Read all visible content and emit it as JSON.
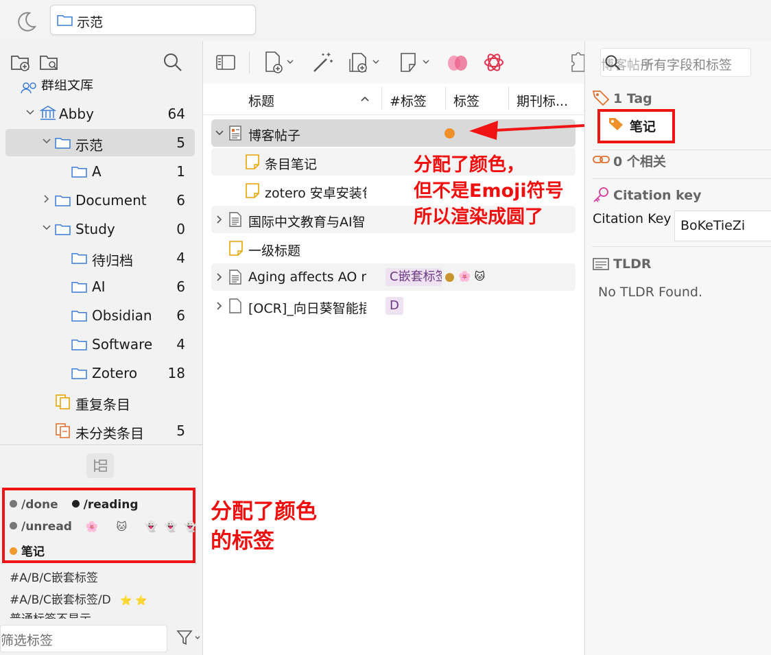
{
  "topbar": {
    "breadcrumb": "示范"
  },
  "library": {
    "group_label": "群组文库",
    "rows": [
      {
        "label": "Abby",
        "count": "64"
      },
      {
        "label": "示范",
        "count": "5"
      },
      {
        "label": "A",
        "count": "1"
      },
      {
        "label": "Document",
        "count": "6"
      },
      {
        "label": "Study",
        "count": "0"
      },
      {
        "label": "待归档",
        "count": "4"
      },
      {
        "label": "AI",
        "count": "6"
      },
      {
        "label": "Obsidian",
        "count": "6"
      },
      {
        "label": "Software",
        "count": "4"
      },
      {
        "label": "Zotero",
        "count": "18"
      },
      {
        "label": "重复条目",
        "count": ""
      },
      {
        "label": "未分类条目",
        "count": "5"
      }
    ]
  },
  "tags": {
    "colored": {
      "done": "/done",
      "reading": "/reading",
      "unread": "/unread",
      "emoji1": "🌸",
      "emoji2": "🐱",
      "emoji3": "👻",
      "emoji4": "👻",
      "emoji5": "👻",
      "note": "笔记"
    },
    "plain": [
      "#A/B/C嵌套标签",
      "#A/B/C嵌套标签/D",
      "普通标签不显示"
    ],
    "plain_stars": "⭐ ⭐",
    "filter_placeholder": "筛选标签",
    "colors": {
      "done": "#777777",
      "reading": "#222222",
      "unread": "#777777",
      "note": "#f09a30"
    }
  },
  "columns": {
    "title": "标题",
    "hashtag": "#标签",
    "tags": "标签",
    "journal": "期刊标..."
  },
  "items": [
    {
      "title": "博客帖子"
    },
    {
      "title": "条目笔记"
    },
    {
      "title": "zotero 安卓安装包"
    },
    {
      "title": "国际中文教育与AI智能"
    },
    {
      "title": "一级标题"
    },
    {
      "title": "Aging affects AO r",
      "chip": "C嵌套标签",
      "emoji": "🌸 🐱"
    },
    {
      "title": "[OCR]_向日葵智能插件",
      "chip": "D"
    }
  ],
  "right": {
    "search_value": "博客帖子",
    "search_placeholder": "所有字段和标签",
    "tag_count": "1 Tag",
    "tag_name": "笔记",
    "related": "0 个相关",
    "citation_header": "Citation key",
    "citation_label": "Citation Key",
    "citation_value": "BoKeTieZi",
    "tldr_header": "TLDR",
    "tldr_text": "No TLDR Found."
  },
  "annotations": {
    "middle": [
      "分配了颜色，",
      "但不是Emoji符号",
      "所以渲染成圆了"
    ],
    "left": [
      "分配了颜色",
      "的标签"
    ]
  }
}
